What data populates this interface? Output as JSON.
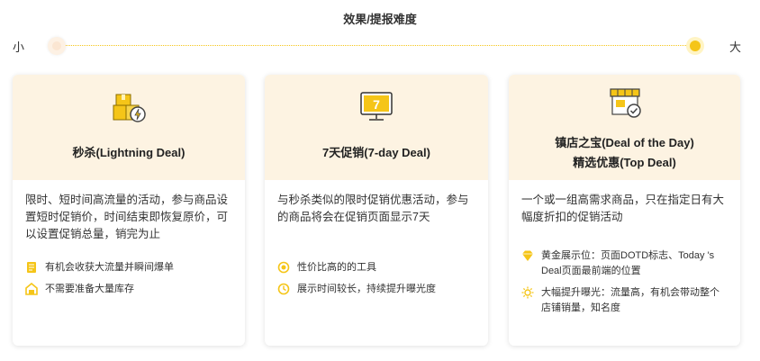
{
  "scale": {
    "title": "效果/提报难度",
    "min_label": "小",
    "max_label": "大"
  },
  "colors": {
    "accent": "#f5c518",
    "card_header_bg": "#fdf3e2"
  },
  "cards": [
    {
      "icon": "boxes-lightning-icon",
      "title_lines": [
        "秒杀(Lightning Deal)"
      ],
      "description": "限时、短时间高流量的活动，参与商品设置短时促销价，时间结束即恢复原价，可以设置促销总量，销完为止",
      "features": [
        {
          "icon": "document-icon",
          "text": "有机会收获大流量并瞬间爆单"
        },
        {
          "icon": "warehouse-icon",
          "text": "不需要准备大量库存"
        }
      ]
    },
    {
      "icon": "monitor-seven-icon",
      "title_lines": [
        "7天促销(7-day Deal)"
      ],
      "description": "与秒杀类似的限时促销优惠活动，参与的商品将会在促销页面显示7天",
      "features": [
        {
          "icon": "coin-icon",
          "text": "性价比高的的工具"
        },
        {
          "icon": "clock-icon",
          "text": "展示时间较长，持续提升曝光度"
        }
      ]
    },
    {
      "icon": "store-check-icon",
      "title_lines": [
        "镇店之宝(Deal of the Day)",
        "精选优惠(Top Deal)"
      ],
      "description": "一个或一组高需求商品，只在指定日有大幅度折扣的促销活动",
      "features": [
        {
          "icon": "diamond-icon",
          "text": "黄金展示位：页面DOTD标志、Today 's Deal页面最前端的位置"
        },
        {
          "icon": "sun-icon",
          "text": "大幅提升曝光：流量高，有机会带动整个店铺销量，知名度"
        }
      ]
    }
  ]
}
